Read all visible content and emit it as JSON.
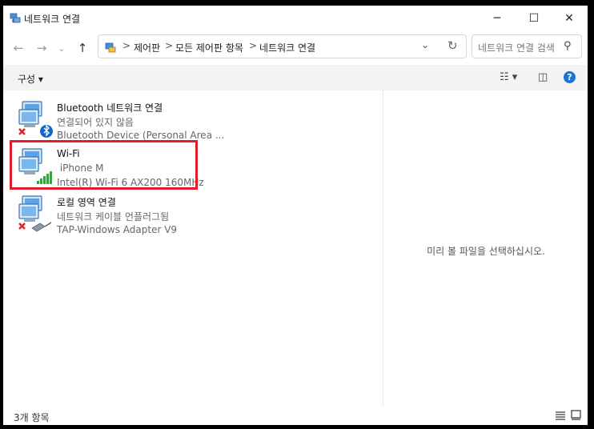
{
  "window": {
    "title": "네트워크 연결",
    "minimize": "─",
    "maximize": "☐",
    "close": "✕"
  },
  "nav": {
    "back": "←",
    "forward": "→",
    "recent": "⌄",
    "up": "↑"
  },
  "breadcrumb": {
    "separator": ">",
    "items": [
      "제어판",
      "모든 제어판 항목",
      "네트워크 연결"
    ]
  },
  "address_controls": {
    "dropdown": "⌄",
    "refresh": "↻"
  },
  "search": {
    "placeholder": "네트워크 연결 검색",
    "icon": "⚲"
  },
  "command_bar": {
    "organize": "구성 ▾",
    "view_options": "☷ ▾",
    "pane": "◫",
    "help": "?"
  },
  "adapters": [
    {
      "name": "Bluetooth 네트워크 연결",
      "status": "연결되어 있지 않음",
      "device": "Bluetooth Device (Personal Area ...",
      "icon": "network-bluetooth-disconnected-icon"
    },
    {
      "name": "Wi-Fi",
      "status": " iPhone M",
      "device": "Intel(R) Wi-Fi 6 AX200 160MHz",
      "icon": "network-wifi-connected-icon"
    },
    {
      "name": "로컬 영역 연결",
      "status": "네트워크 케이블 언플러그됨",
      "device": "TAP-Windows Adapter V9",
      "icon": "network-ethernet-unplugged-icon"
    }
  ],
  "preview": {
    "message": "미리 볼 파일을 선택하십시오."
  },
  "status_bar": {
    "count": "3개 항목"
  },
  "colors": {
    "highlight": "#e01d2b",
    "help_blue": "#1a73d6"
  }
}
